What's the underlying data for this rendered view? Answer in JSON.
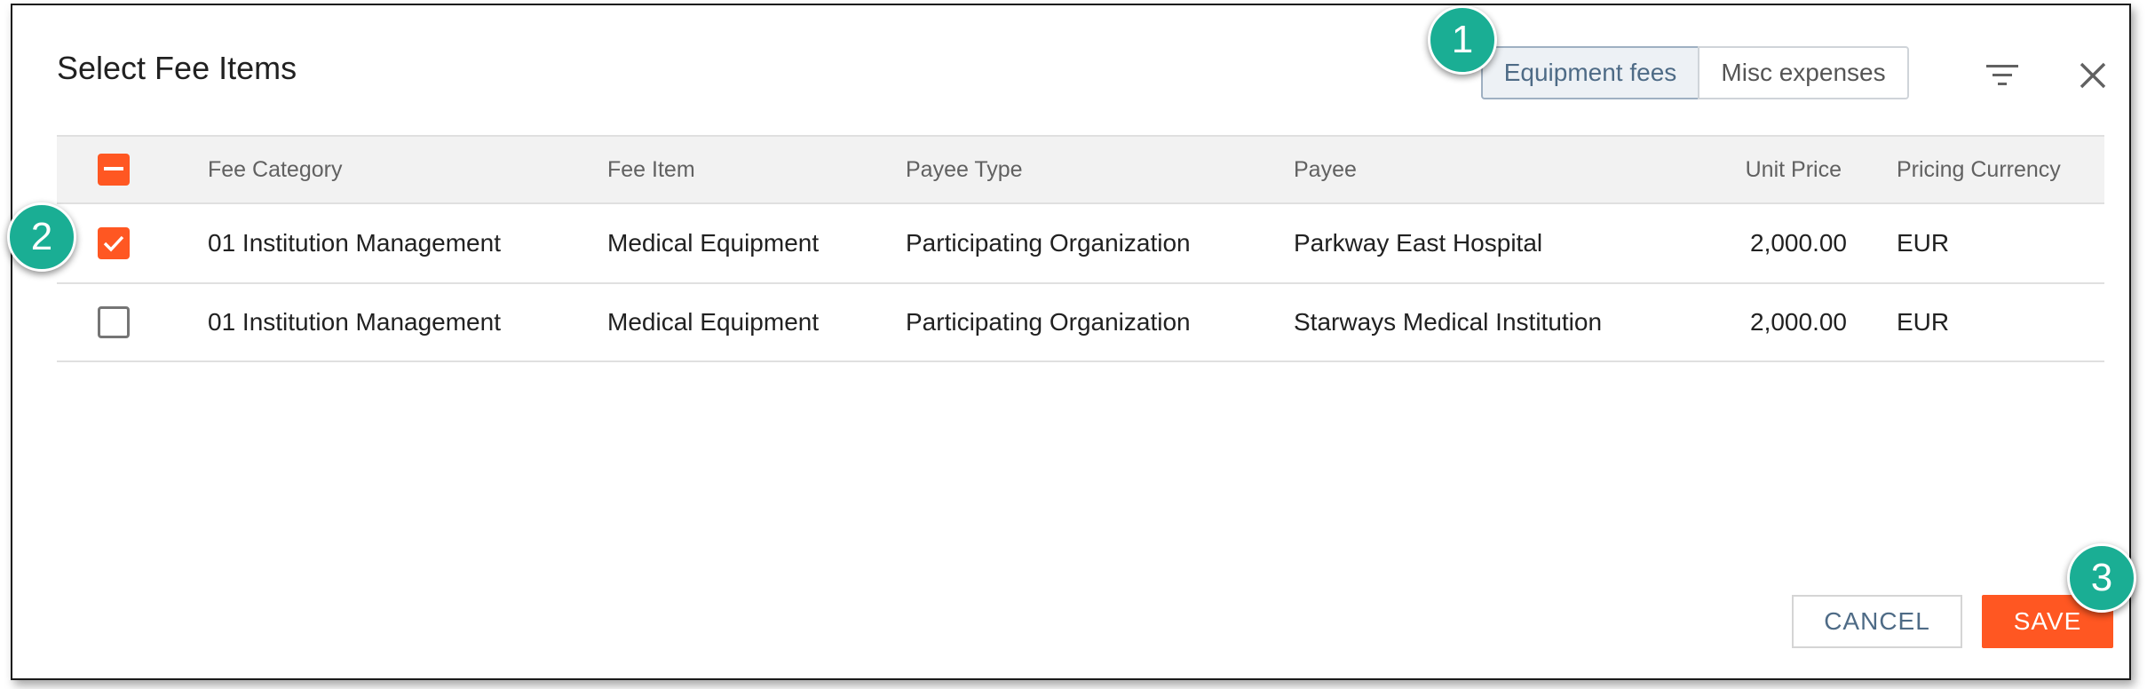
{
  "dialog": {
    "title": "Select Fee Items",
    "tabs": [
      {
        "label": "Equipment fees",
        "active": true
      },
      {
        "label": "Misc expenses",
        "active": false
      }
    ],
    "icons": {
      "filter": "filter-icon",
      "close": "close-icon"
    }
  },
  "table": {
    "columns": [
      "Fee Category",
      "Fee Item",
      "Payee Type",
      "Payee",
      "Unit Price",
      "Pricing Currency"
    ],
    "header_checkbox": "indeterminate",
    "rows": [
      {
        "checked": true,
        "category": "01 Institution Management",
        "item": "Medical Equipment",
        "payee_type": "Participating Organization",
        "payee": "Parkway East Hospital",
        "unit_price": "2,000.00",
        "currency": "EUR"
      },
      {
        "checked": false,
        "category": "01 Institution Management",
        "item": "Medical Equipment",
        "payee_type": "Participating Organization",
        "payee": "Starways Medical Institution",
        "unit_price": "2,000.00",
        "currency": "EUR"
      }
    ]
  },
  "footer": {
    "cancel_label": "CANCEL",
    "save_label": "SAVE"
  },
  "markers": [
    "1",
    "2",
    "3"
  ],
  "colors": {
    "accent": "#ff5722",
    "marker": "#1aae94",
    "active_tab": "#edf1f5"
  }
}
